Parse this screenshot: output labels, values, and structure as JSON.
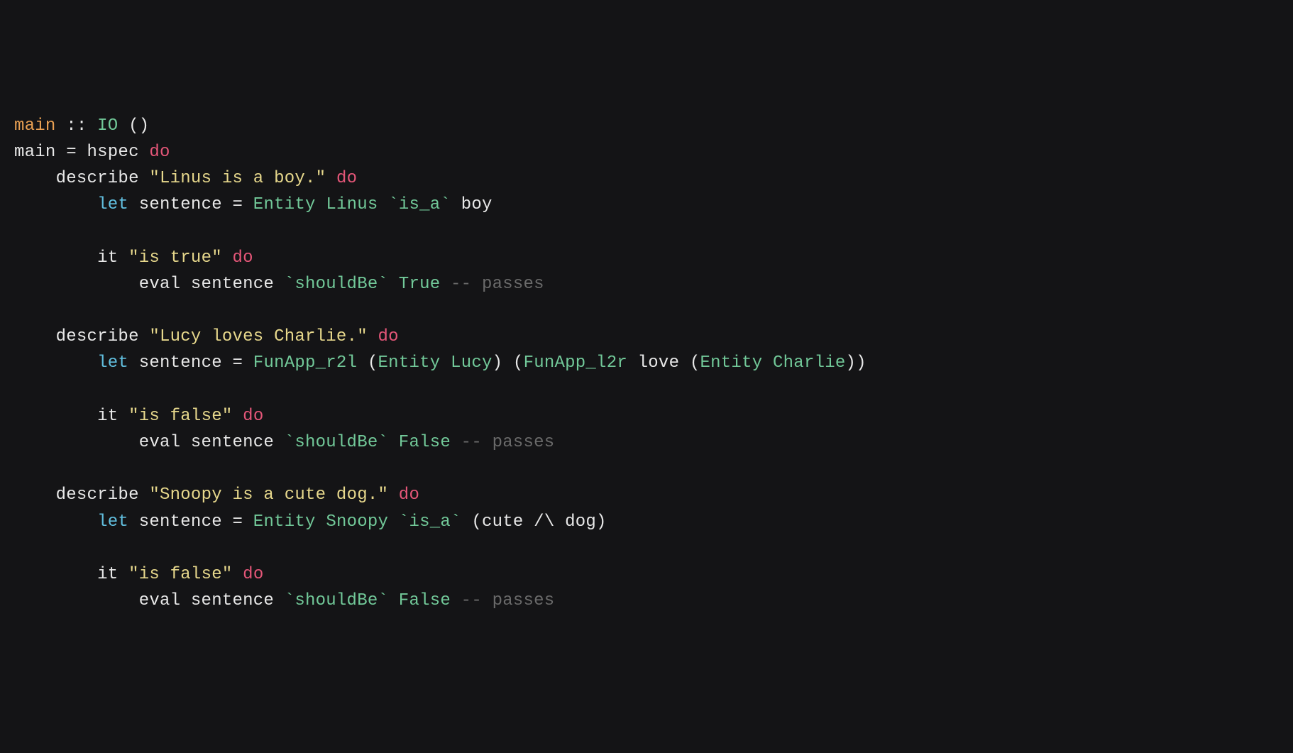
{
  "line1": {
    "main": "main",
    "colons": " :: ",
    "io": "IO",
    "unit": " ()"
  },
  "line2": {
    "main_eq": "main = hspec ",
    "do": "do"
  },
  "line3": {
    "indent": "    describe ",
    "str": "\"Linus is a boy.\"",
    "sp": " ",
    "do": "do"
  },
  "line4": {
    "indent": "        ",
    "let": "let",
    "sentence_eq": " sentence = ",
    "entity": "Entity",
    "sp1": " ",
    "linus": "Linus",
    "sp2": " ",
    "is_a": "`is_a`",
    "rest": " boy"
  },
  "line5": {
    "indent": "        it ",
    "str": "\"is true\"",
    "sp": " ",
    "do": "do"
  },
  "line6": {
    "indent": "            eval sentence ",
    "shouldbe": "`shouldBe`",
    "sp": " ",
    "true": "True",
    "sp2": " ",
    "comment": "-- passes"
  },
  "line7": {
    "indent": "    describe ",
    "str": "\"Lucy loves Charlie.\"",
    "sp": " ",
    "do": "do"
  },
  "line8": {
    "indent": "        ",
    "let": "let",
    "sentence_eq": " sentence = ",
    "funapp1": "FunApp_r2l",
    "paren_o1": " (",
    "entity1": "Entity",
    "sp1": " ",
    "lucy": "Lucy",
    "paren_c1": ") (",
    "funapp2": "FunApp_l2r",
    "love": " love (",
    "entity2": "Entity",
    "sp2": " ",
    "charlie": "Charlie",
    "paren_c2": "))"
  },
  "line9": {
    "indent": "        it ",
    "str": "\"is false\"",
    "sp": " ",
    "do": "do"
  },
  "line10": {
    "indent": "            eval sentence ",
    "shouldbe": "`shouldBe`",
    "sp": " ",
    "false": "False",
    "sp2": " ",
    "comment": "-- passes"
  },
  "line11": {
    "indent": "    describe ",
    "str": "\"Snoopy is a cute dog.\"",
    "sp": " ",
    "do": "do"
  },
  "line12": {
    "indent": "        ",
    "let": "let",
    "sentence_eq": " sentence = ",
    "entity": "Entity",
    "sp1": " ",
    "snoopy": "Snoopy",
    "sp2": " ",
    "is_a": "`is_a`",
    "rest": " (cute /\\ dog)"
  },
  "line13": {
    "indent": "        it ",
    "str": "\"is false\"",
    "sp": " ",
    "do": "do"
  },
  "line14": {
    "indent": "            eval sentence ",
    "shouldbe": "`shouldBe`",
    "sp": " ",
    "false": "False",
    "sp2": " ",
    "comment": "-- passes"
  }
}
